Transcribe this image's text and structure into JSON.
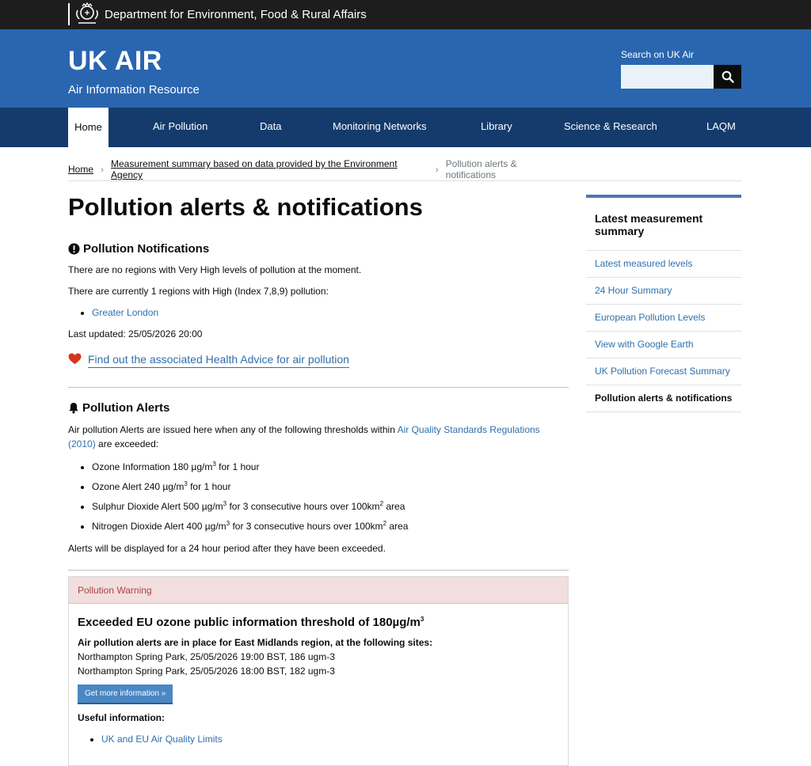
{
  "topbar": {
    "department": "Department for Environment, Food & Rural Affairs"
  },
  "masthead": {
    "brand": "UK AIR",
    "tagline": "Air Information Resource",
    "search_label": "Search on UK Air",
    "search_value": ""
  },
  "nav": {
    "items": [
      "Home",
      "Air Pollution",
      "Data",
      "Monitoring Networks",
      "Library",
      "Science & Research",
      "LAQM"
    ],
    "active": "Home"
  },
  "breadcrumb": {
    "home": "Home",
    "parent": "Measurement summary based on data provided by the Environment Agency",
    "current": "Pollution alerts & notifications"
  },
  "page": {
    "title": "Pollution alerts & notifications",
    "notifications": {
      "heading": "Pollution Notifications",
      "very_high_text": "There are no regions with Very High levels of pollution at the moment.",
      "high_text": "There are currently 1 regions with High (Index 7,8,9) pollution:",
      "regions": [
        "Greater London"
      ],
      "last_updated": "Last updated: 25/05/2026 20:00",
      "health_link": "Find out the associated Health Advice for air pollution"
    },
    "alerts": {
      "heading": "Pollution Alerts",
      "intro_before": "Air pollution Alerts are issued here when any of the following thresholds within ",
      "intro_link": "Air Quality Standards Regulations (2010)",
      "intro_after": " are exceeded:",
      "thresholds": [
        {
          "a": "Ozone Information 180 µg/m",
          "sup1": "3",
          "b": " for 1 hour",
          "sup2": "",
          "c": ""
        },
        {
          "a": "Ozone Alert 240 µg/m",
          "sup1": "3",
          "b": " for 1 hour",
          "sup2": "",
          "c": ""
        },
        {
          "a": "Sulphur Dioxide Alert 500 µg/m",
          "sup1": "3",
          "b": " for 3 consecutive hours over 100km",
          "sup2": "2",
          "c": " area"
        },
        {
          "a": "Nitrogen Dioxide Alert 400 µg/m",
          "sup1": "3",
          "b": " for 3 consecutive hours over 100km",
          "sup2": "2",
          "c": " area"
        }
      ],
      "display_note": "Alerts will be displayed for a 24 hour period after they have been exceeded."
    },
    "warning": {
      "label": "Pollution Warning",
      "heading": "Exceeded EU ozone public information threshold of 180µg/m",
      "heading_sup": "3",
      "region_text": "Air pollution alerts are in place for East Midlands region, at the following sites:",
      "sites": [
        "Northampton Spring Park, 25/05/2026 19:00 BST, 186 ugm-3",
        "Northampton Spring Park, 25/05/2026 18:00 BST, 182 ugm-3"
      ],
      "button": "Get more information »",
      "useful_heading": "Useful information:",
      "useful_links": [
        "UK and EU Air Quality Limits"
      ]
    }
  },
  "sidebar": {
    "title": "Latest measurement summary",
    "links": [
      "Latest measured levels",
      "24 Hour Summary",
      "European Pollution Levels",
      "View with Google Earth",
      "UK Pollution Forecast Summary",
      "Pollution alerts & notifications"
    ]
  },
  "colors": {
    "header_blue": "#2a65b0",
    "nav_navy": "#143b6c",
    "link_blue": "#2f6fad",
    "warning_bg": "#f2dede",
    "warning_text": "#a94442",
    "heart_red": "#d4351c"
  }
}
